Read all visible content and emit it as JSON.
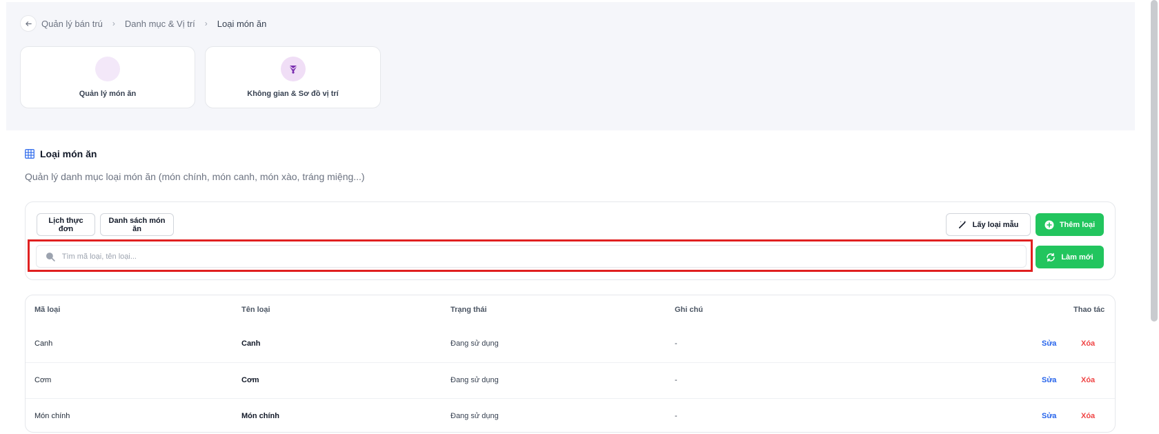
{
  "breadcrumb": {
    "items": [
      "Quản lý bán trú",
      "Danh mục & Vị trí",
      "Loại món ăn"
    ],
    "separator": "›"
  },
  "cards": [
    {
      "label": "Quản lý món ăn",
      "icon": "dish-icon",
      "color": "#f3e8f9"
    },
    {
      "label": "Không gian & Sơ đồ vị trí",
      "icon": "map-icon",
      "color": "#f0def6"
    }
  ],
  "section": {
    "title": "Loại món ăn",
    "description": "Quản lý danh mục loại món ăn (món chính, món canh, món xào, tráng miệng...)"
  },
  "toolbar": {
    "menu_schedule_label": "Lịch thực đơn",
    "dish_list_label": "Danh sách món ăn",
    "sample_label": "Lấy loại mẫu",
    "add_label": "Thêm loại",
    "refresh_label": "Làm mới"
  },
  "search": {
    "placeholder": "Tìm mã loại, tên loại...",
    "value": ""
  },
  "table": {
    "headers": {
      "code": "Mã loại",
      "name": "Tên loại",
      "status": "Trạng thái",
      "note": "Ghi chú",
      "actions": "Thao tác"
    },
    "rows": [
      {
        "code": "Canh",
        "name": "Canh",
        "status": "Đang sử dụng",
        "note": "-",
        "edit": "Sửa",
        "delete": "Xóa"
      },
      {
        "code": "Cơm",
        "name": "Cơm",
        "status": "Đang sử dụng",
        "note": "-",
        "edit": "Sửa",
        "delete": "Xóa"
      },
      {
        "code": "Món chính",
        "name": "Món chính",
        "status": "Đang sử dụng",
        "note": "-",
        "edit": "Sửa",
        "delete": "Xóa"
      }
    ]
  },
  "colors": {
    "accent_green": "#22c55e",
    "edit_blue": "#2563eb",
    "delete_red": "#ef4444",
    "highlight_red": "#e02020"
  }
}
